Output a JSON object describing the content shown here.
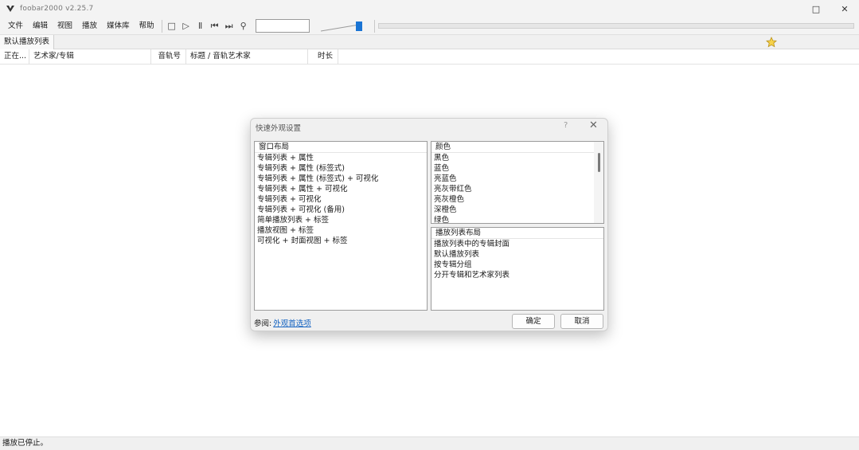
{
  "window": {
    "title": "foobar2000 v2.25.7",
    "minimize_glyph": "—",
    "maximize_glyph": "□",
    "close_glyph": "✕"
  },
  "menu": [
    "文件",
    "编辑",
    "视图",
    "播放",
    "媒体库",
    "帮助"
  ],
  "toolbar": {
    "buttons": [
      {
        "name": "stop-icon",
        "glyph": "□"
      },
      {
        "name": "play-icon",
        "glyph": "▷"
      },
      {
        "name": "pause-icon",
        "glyph": "Ⅱ"
      },
      {
        "name": "previous-icon",
        "glyph": "⏮"
      },
      {
        "name": "next-icon",
        "glyph": "⏭"
      },
      {
        "name": "random-icon",
        "glyph": "⚲"
      }
    ],
    "volume_level": 0.92,
    "seek_position": 0
  },
  "playlist_tab": {
    "label": "默认播放列表"
  },
  "columns": [
    {
      "key": "status",
      "label": "正在..."
    },
    {
      "key": "artist_album",
      "label": "艺术家/专辑"
    },
    {
      "key": "track_no",
      "label": "音轨号"
    },
    {
      "key": "title",
      "label": "标题 / 音轨艺术家"
    },
    {
      "key": "duration",
      "label": "时长"
    }
  ],
  "status_bar": {
    "text": "播放已停止。"
  },
  "dialog": {
    "title": "快速外观设置",
    "help_glyph": "?",
    "close_glyph": "✕",
    "layout_panel": {
      "header": "窗口布局",
      "items": [
        "专辑列表 + 属性",
        "专辑列表 + 属性 (标签式)",
        "专辑列表 + 属性 (标签式) + 可视化",
        "专辑列表 + 属性 + 可视化",
        "专辑列表 + 可视化",
        "专辑列表 + 可视化 (备用)",
        "简单播放列表 + 标签",
        "播放视图 + 标签",
        "可视化 + 封面视图 + 标签"
      ]
    },
    "color_panel": {
      "header": "颜色",
      "items": [
        "黑色",
        "蓝色",
        "亮蓝色",
        "亮灰带红色",
        "亮灰橙色",
        "深橙色",
        "绿色"
      ]
    },
    "playlist_panel": {
      "header": "播放列表布局",
      "items": [
        "播放列表中的专辑封面",
        "默认播放列表",
        "按专辑分组",
        "分开专辑和艺术家列表"
      ]
    },
    "hint_label": "参阅:",
    "hint_link": "外观首选项",
    "ok_label": "确定",
    "cancel_label": "取消"
  }
}
